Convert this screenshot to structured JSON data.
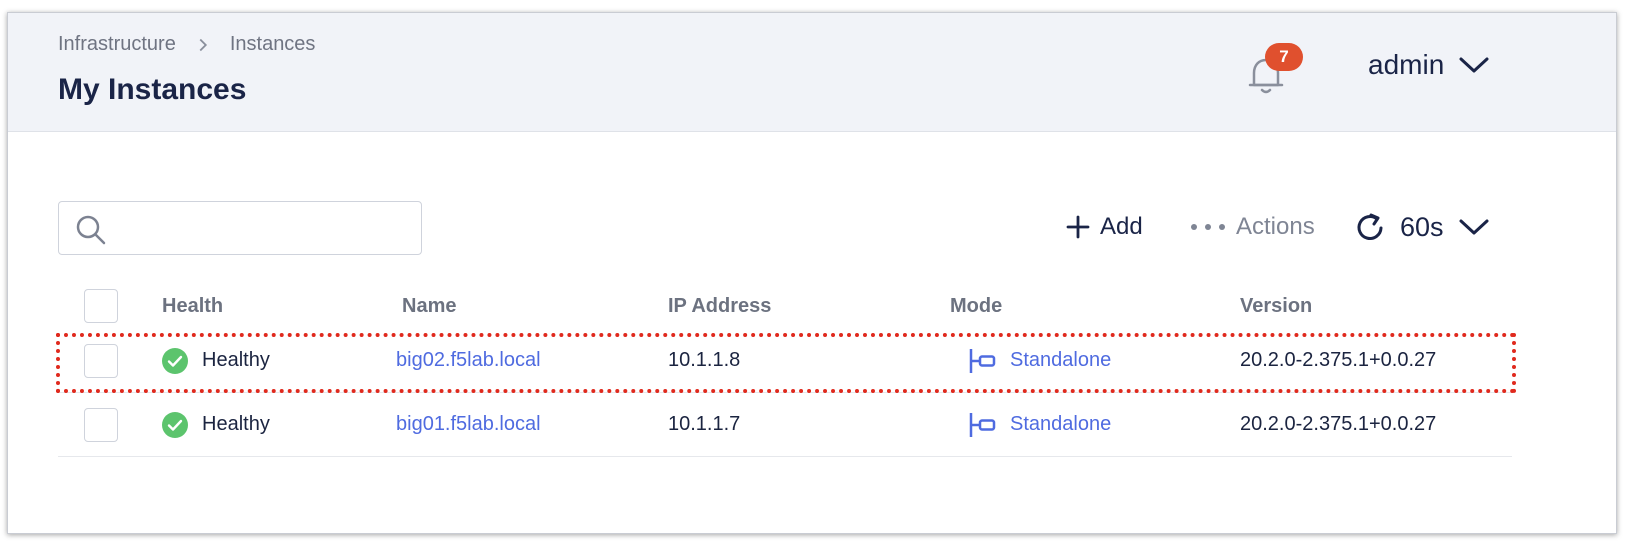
{
  "header": {
    "breadcrumb": [
      "Infrastructure",
      "Instances"
    ],
    "title": "My Instances",
    "notification_count": "7",
    "user": "admin"
  },
  "toolbar": {
    "search_placeholder": "",
    "add_label": "Add",
    "actions_label": "Actions",
    "refresh_interval": "60s"
  },
  "table": {
    "columns": [
      "Health",
      "Name",
      "IP Address",
      "Mode",
      "Version"
    ],
    "rows": [
      {
        "health": "Healthy",
        "name": "big02.f5lab.local",
        "ip": "10.1.1.8",
        "mode": "Standalone",
        "version": "20.2.0-2.375.1+0.0.27"
      },
      {
        "health": "Healthy",
        "name": "big01.f5lab.local",
        "ip": "10.1.1.7",
        "mode": "Standalone",
        "version": "20.2.0-2.375.1+0.0.27"
      }
    ]
  },
  "colors": {
    "accent": "#4f6be0",
    "healthy": "#5cc46d",
    "badge": "#e0502e",
    "highlight": "#e0291d"
  }
}
